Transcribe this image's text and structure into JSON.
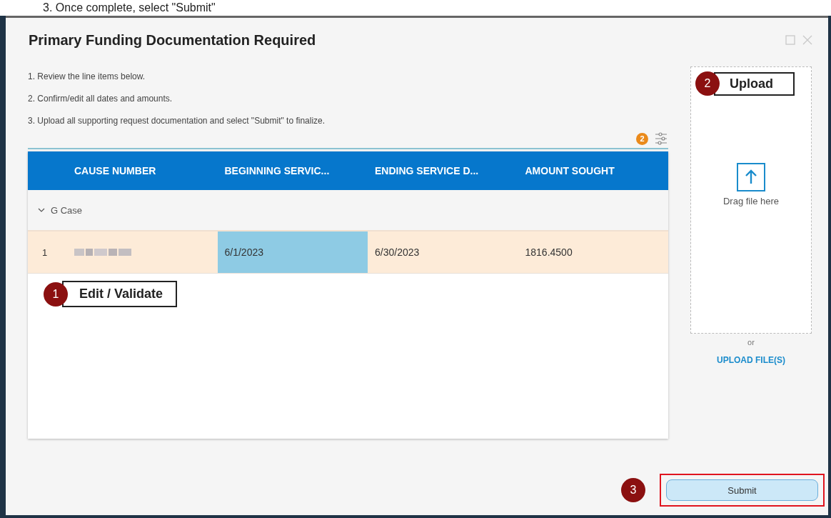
{
  "top_caption": "3. Once complete, select \"Submit\"",
  "dialog": {
    "title": "Primary Funding Documentation Required",
    "instructions": [
      "1. Review the line items below.",
      "2. Confirm/edit all dates and amounts.",
      "3. Upload all supporting request documentation and select \"Submit\" to finalize."
    ],
    "filter_count": "2",
    "table": {
      "columns": [
        "CAUSE NUMBER",
        "BEGINNING SERVIC...",
        "ENDING SERVICE D...",
        "AMOUNT SOUGHT"
      ],
      "groups": [
        {
          "label": "G Case",
          "expanded": true,
          "rows": [
            {
              "index": "1",
              "redacted_cause": true,
              "cells": [
                {
                  "text": "6/1/2023",
                  "selected": true
                },
                {
                  "text": "6/30/2023",
                  "selected": false
                },
                {
                  "text": "1816.4500",
                  "selected": false
                }
              ]
            }
          ]
        }
      ]
    },
    "upload": {
      "hint": "Drag file here",
      "separator": "or",
      "link": "UPLOAD FILE(S)"
    },
    "submit": "Submit",
    "callouts": [
      {
        "number": "1",
        "label": "Edit / Validate"
      },
      {
        "number": "2",
        "label": "Upload"
      },
      {
        "number": "3"
      }
    ]
  }
}
